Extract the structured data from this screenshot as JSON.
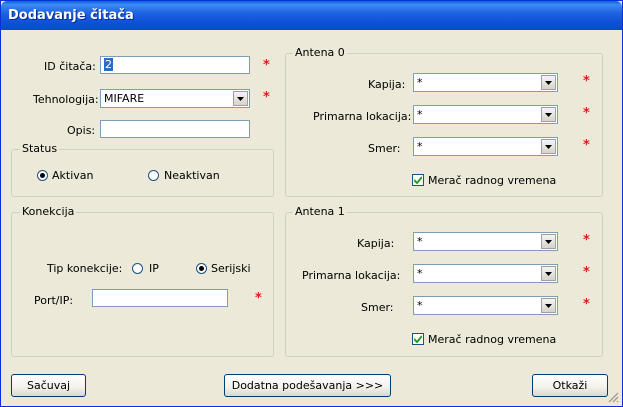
{
  "window": {
    "title": "Dodavanje čitača"
  },
  "reader": {
    "id_label": "ID čitača:",
    "id_value": "2",
    "tech_label": "Tehnologija:",
    "tech_value": "MIFARE",
    "desc_label": "Opis:",
    "desc_value": ""
  },
  "required_mark": "*",
  "status": {
    "legend": "Status",
    "active_label": "Aktivan",
    "inactive_label": "Neaktivan",
    "selected": "active"
  },
  "connection": {
    "legend": "Konekcija",
    "type_label": "Tip konekcije:",
    "ip_label": "IP",
    "serial_label": "Serijski",
    "selected": "serial",
    "port_label": "Port/IP:",
    "port_value": ""
  },
  "antenna0": {
    "legend": "Antena 0",
    "gate_label": "Kapija:",
    "gate_value": "*",
    "location_label": "Primarna lokacija:",
    "location_value": "*",
    "direction_label": "Smer:",
    "direction_value": "*",
    "timer_label": "Merač radnog vremena",
    "timer_checked": true
  },
  "antenna1": {
    "legend": "Antena 1",
    "gate_label": "Kapija:",
    "gate_value": "*",
    "location_label": "Primarna lokacija:",
    "location_value": "*",
    "direction_label": "Smer:",
    "direction_value": "*",
    "timer_label": "Merač radnog vremena",
    "timer_checked": true
  },
  "buttons": {
    "save": "Sačuvaj",
    "advanced": "Dodatna podešavanja >>>",
    "cancel": "Otkaži"
  }
}
